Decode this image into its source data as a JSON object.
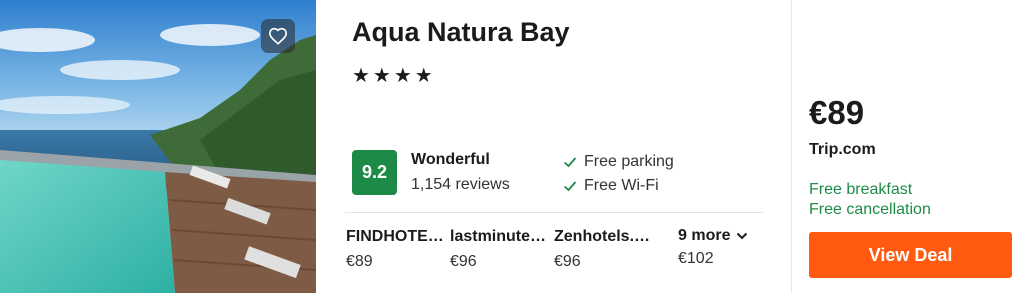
{
  "hotel": {
    "name": "Aqua Natura Bay",
    "stars": "★★★★",
    "score": "9.2",
    "rating_label": "Wonderful",
    "reviews": "1,154 reviews",
    "amenities": [
      "Free parking",
      "Free Wi-Fi"
    ]
  },
  "deals": [
    {
      "provider": "FINDHOTEL.net",
      "price": "€89"
    },
    {
      "provider": "lastminute.com",
      "price": "€96"
    },
    {
      "provider": "Zenhotels.com",
      "price": "€96"
    }
  ],
  "more": {
    "label": "9 more",
    "price": "€102"
  },
  "best": {
    "price": "€89",
    "site": "Trip.com",
    "perks": [
      "Free breakfast",
      "Free cancellation"
    ],
    "button": "View Deal"
  },
  "icons": {
    "favorite": "heart-icon",
    "amenity": "check-icon",
    "more": "chevron-down-icon"
  },
  "colors": {
    "score_bg": "#1e8a47",
    "perk_text": "#1e8a47",
    "cta": "#ff5a10"
  }
}
